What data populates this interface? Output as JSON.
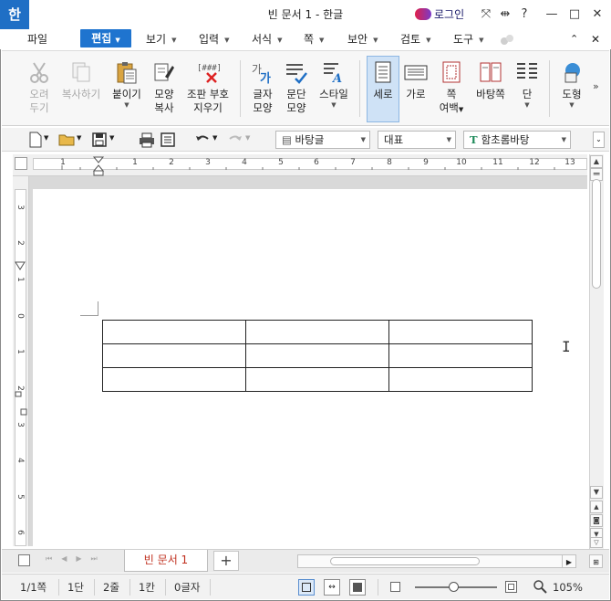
{
  "window": {
    "title": "빈 문서 1 - 한글",
    "app_logo": "한",
    "login_label": "로그인",
    "system_buttons": [
      "⤧",
      "⇹",
      "?",
      "—",
      "□",
      "✕"
    ]
  },
  "menu": {
    "file": "파일",
    "edit": "편집",
    "items": [
      "보기",
      "입력",
      "서식",
      "쪽",
      "보안",
      "검토",
      "도구"
    ]
  },
  "ribbon": {
    "cut": {
      "line1": "오려",
      "line2": "두기"
    },
    "copy": {
      "line1": "복사하기"
    },
    "paste": {
      "line1": "붙이기"
    },
    "format_copy": {
      "line1": "모양",
      "line2": "복사"
    },
    "clear_marks": {
      "line1": "조판 부호",
      "line2": "지우기"
    },
    "char_shape": {
      "line1": "글자",
      "line2": "모양"
    },
    "para_shape": {
      "line1": "문단",
      "line2": "모양"
    },
    "style": {
      "line1": "스타일"
    },
    "portrait": {
      "line1": "세로"
    },
    "landscape": {
      "line1": "가로"
    },
    "page_margin": {
      "line1": "쪽",
      "line2": "여백"
    },
    "facing_pages": {
      "line1": "바탕쪽"
    },
    "columns": {
      "line1": "단"
    },
    "shapes": {
      "line1": "도형"
    },
    "more": "»"
  },
  "toolbar2": {
    "style_combo": "바탕글",
    "language_combo": "대표",
    "font_combo": "함초롬바탕"
  },
  "ruler": {
    "h_numbers": [
      "1",
      "1",
      "2",
      "3",
      "4",
      "5",
      "6",
      "7",
      "8",
      "9",
      "10",
      "11",
      "12",
      "13"
    ],
    "v_numbers": [
      "3",
      "2",
      "1",
      "0",
      "1",
      "2",
      "3",
      "4",
      "5",
      "6"
    ]
  },
  "document": {
    "table_rows": 3,
    "table_cols": 3
  },
  "tabs": {
    "doc_tab": "빈 문서 1",
    "add_tab": "+"
  },
  "status": {
    "page": "1/1쪽",
    "column": "1단",
    "line": "2줄",
    "cell": "1칸",
    "chars": "0글자",
    "zoom": "105%"
  }
}
